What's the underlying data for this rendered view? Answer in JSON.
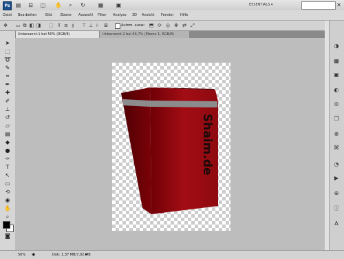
{
  "app": {
    "logo": "Ps",
    "workspace_label": "ESSENTIALS ▾",
    "search_placeholder": ""
  },
  "menu": [
    "Datei",
    "Bearbeiten",
    "Bild",
    "Ebene",
    "Auswahl",
    "Filter",
    "Analyse",
    "3D",
    "Ansicht",
    "Fenster",
    "Hilfe"
  ],
  "options": {
    "autoselect_label": "Autom. ausw.:"
  },
  "tabs": [
    {
      "label": "Unbenannt-1 bei 50% (RGB/8)",
      "active": true
    },
    {
      "label": "Unbenannt-2 bei 66,7% (Ebene 1, RGB/8)",
      "active": false
    }
  ],
  "canvas": {
    "box_text": "Shaim.de",
    "box_color": "#9a0a10",
    "stripe_color": "#8c8c8c"
  },
  "status": {
    "zoom": "50%",
    "doc_info": "Dok: 1,37 MB/7,02 MB"
  },
  "icons": {
    "tools": [
      "move-icon",
      "marquee-icon",
      "lasso-icon",
      "quick-select-icon",
      "crop-icon",
      "eyedropper-icon",
      "healing-icon",
      "brush-icon",
      "stamp-icon",
      "history-brush-icon",
      "eraser-icon",
      "gradient-icon",
      "blur-icon",
      "dodge-icon",
      "pen-icon",
      "type-icon",
      "path-select-icon",
      "shape-icon",
      "3d-rotate-icon",
      "3d-orbit-icon",
      "hand-icon",
      "zoom-icon"
    ],
    "dock": [
      "color-icon",
      "swatches-icon",
      "styles-icon",
      "adjustments-icon",
      "masks-icon",
      "layers-icon",
      "channels-icon",
      "paths-icon"
    ]
  }
}
